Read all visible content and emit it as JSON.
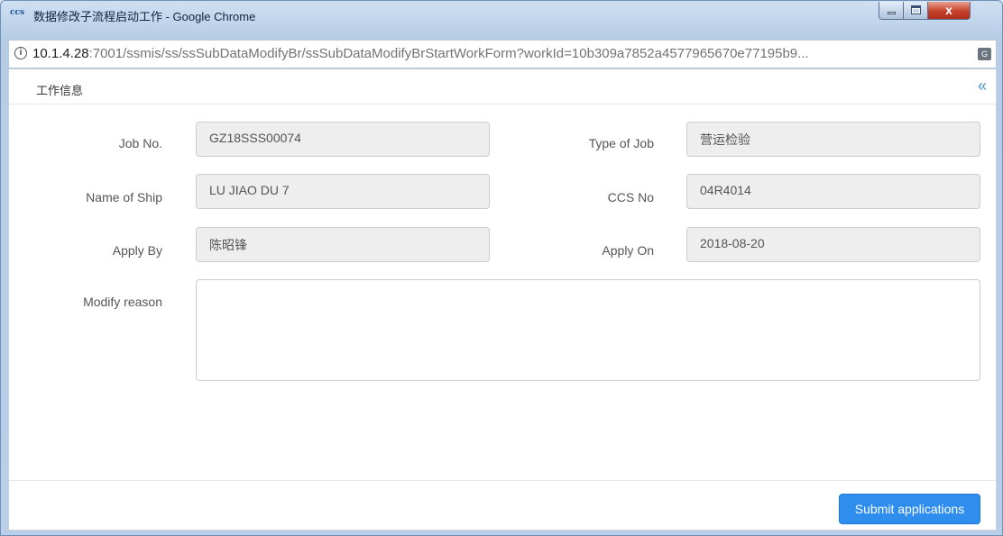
{
  "window": {
    "logo_text": "ccs",
    "title": "数据修改子流程启动工作 - Google Chrome",
    "close_glyph": "x"
  },
  "address_bar": {
    "url_host": "10.1.4.28",
    "url_path": ":7001/ssmis/ss/ssSubDataModifyBr/ssSubDataModifyBrStartWorkForm?workId=10b309a7852a4577965670e77195b9..."
  },
  "page": {
    "title": "工作信息",
    "collapse_glyph": "«"
  },
  "form": {
    "job_no_label": "Job No.",
    "job_no_value": "GZ18SSS00074",
    "type_of_job_label": "Type of Job",
    "type_of_job_value": "营运检验",
    "name_of_ship_label": "Name of Ship",
    "name_of_ship_value": "LU JIAO DU 7",
    "ccs_no_label": "CCS No",
    "ccs_no_value": "04R4014",
    "apply_by_label": "Apply By",
    "apply_by_value": "陈昭锋",
    "apply_on_label": "Apply On",
    "apply_on_value": "2018-08-20",
    "modify_reason_label": "Modify reason",
    "modify_reason_value": ""
  },
  "footer": {
    "submit_label": "Submit applications"
  },
  "colors": {
    "accent": "#2e8ded",
    "close_button": "#c6412a"
  }
}
